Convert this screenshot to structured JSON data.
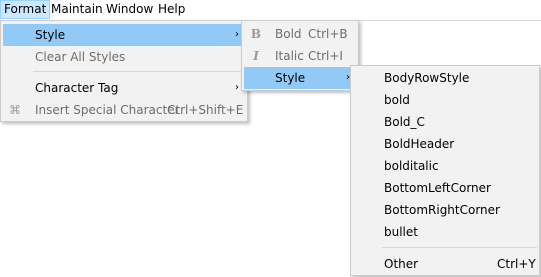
{
  "menubar": {
    "items": [
      "Format",
      "Maintain",
      "Window",
      "Help"
    ]
  },
  "format_menu": {
    "style": "Style",
    "clear_all_styles": "Clear All Styles",
    "character_tag": "Character Tag",
    "insert_special_character": "Insert Special Character",
    "insert_special_character_shortcut": "Ctrl+Shift+E"
  },
  "style_menu": {
    "bold": "Bold",
    "bold_shortcut": "Ctrl+B",
    "italic": "Italic",
    "italic_shortcut": "Ctrl+I",
    "style": "Style"
  },
  "style_list": {
    "items": [
      "BodyRowStyle",
      "bold",
      "Bold_C",
      "BoldHeader",
      "bolditalic",
      "BottomLeftCorner",
      "BottomRightCorner",
      "bullet"
    ],
    "other": "Other",
    "other_shortcut": "Ctrl+Y"
  },
  "icons": {
    "bold": "bold-icon",
    "italic": "italic-icon",
    "special_character": "special-character-icon",
    "submenu": "chevron-right-icon"
  }
}
